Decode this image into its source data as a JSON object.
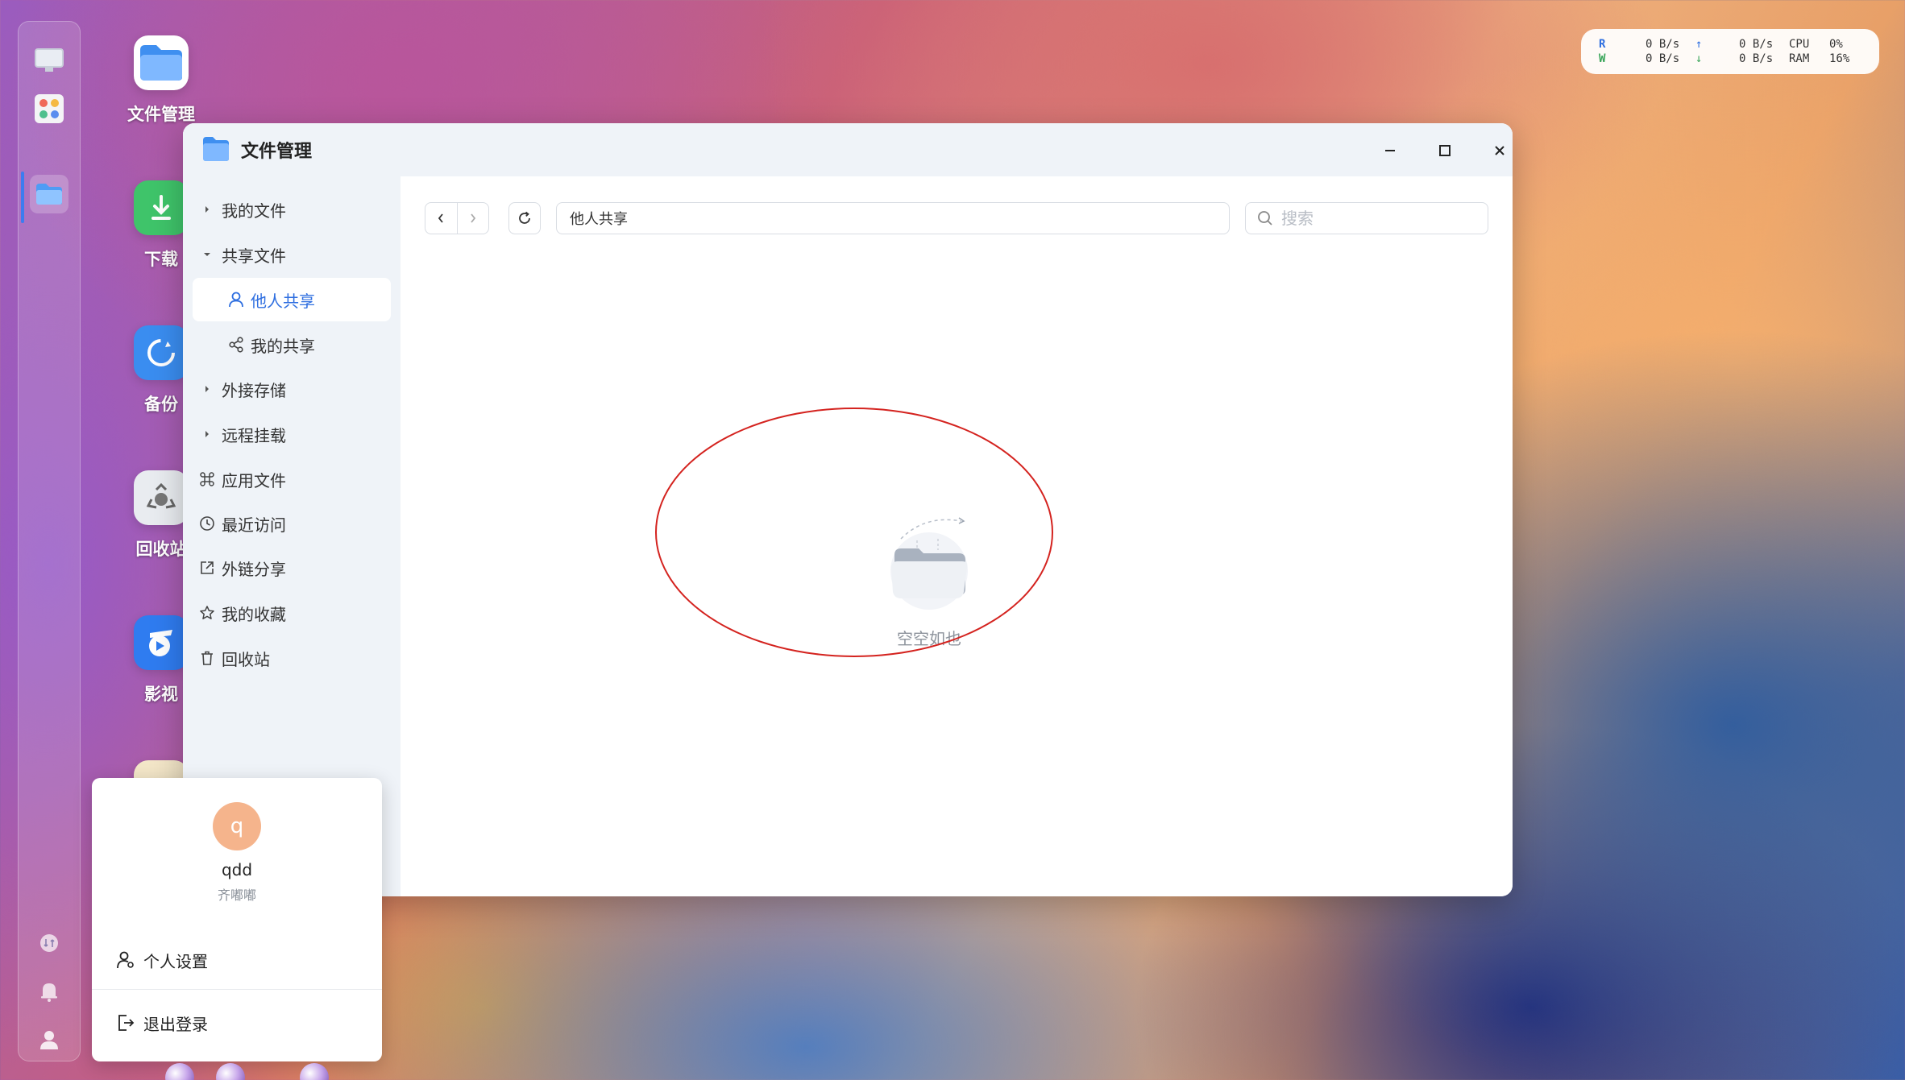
{
  "desktop": {
    "icons": [
      {
        "label": "文件管理"
      },
      {
        "label": "下载"
      },
      {
        "label": "备份"
      },
      {
        "label": "回收站"
      },
      {
        "label": "影视"
      }
    ]
  },
  "status": {
    "read_label": "R",
    "write_label": "W",
    "read_speed_1": "0 B/s",
    "write_speed_1": "0 B/s",
    "read_speed_2": "0 B/s",
    "write_speed_2": "0 B/s",
    "cpu_label": "CPU",
    "ram_label": "RAM",
    "cpu_value": "0%",
    "ram_value": "16%"
  },
  "window": {
    "title": "文件管理"
  },
  "sidebar": {
    "items": [
      {
        "label": "我的文件"
      },
      {
        "label": "共享文件"
      },
      {
        "label": "他人共享"
      },
      {
        "label": "我的共享"
      },
      {
        "label": "外接存储"
      },
      {
        "label": "远程挂载"
      },
      {
        "label": "应用文件"
      },
      {
        "label": "最近访问"
      },
      {
        "label": "外链分享"
      },
      {
        "label": "我的收藏"
      },
      {
        "label": "回收站"
      }
    ]
  },
  "toolbar": {
    "path_value": "他人共享",
    "search_placeholder": "搜索"
  },
  "empty_state": {
    "label": "空空如也"
  },
  "user_menu": {
    "avatar_letter": "q",
    "username": "qdd",
    "display_name": "齐嘟嘟",
    "settings_label": "个人设置",
    "logout_label": "退出登录"
  },
  "colors": {
    "accent": "#2f6fe0",
    "annotation": "#d4231f",
    "avatar": "#f5b48c"
  }
}
